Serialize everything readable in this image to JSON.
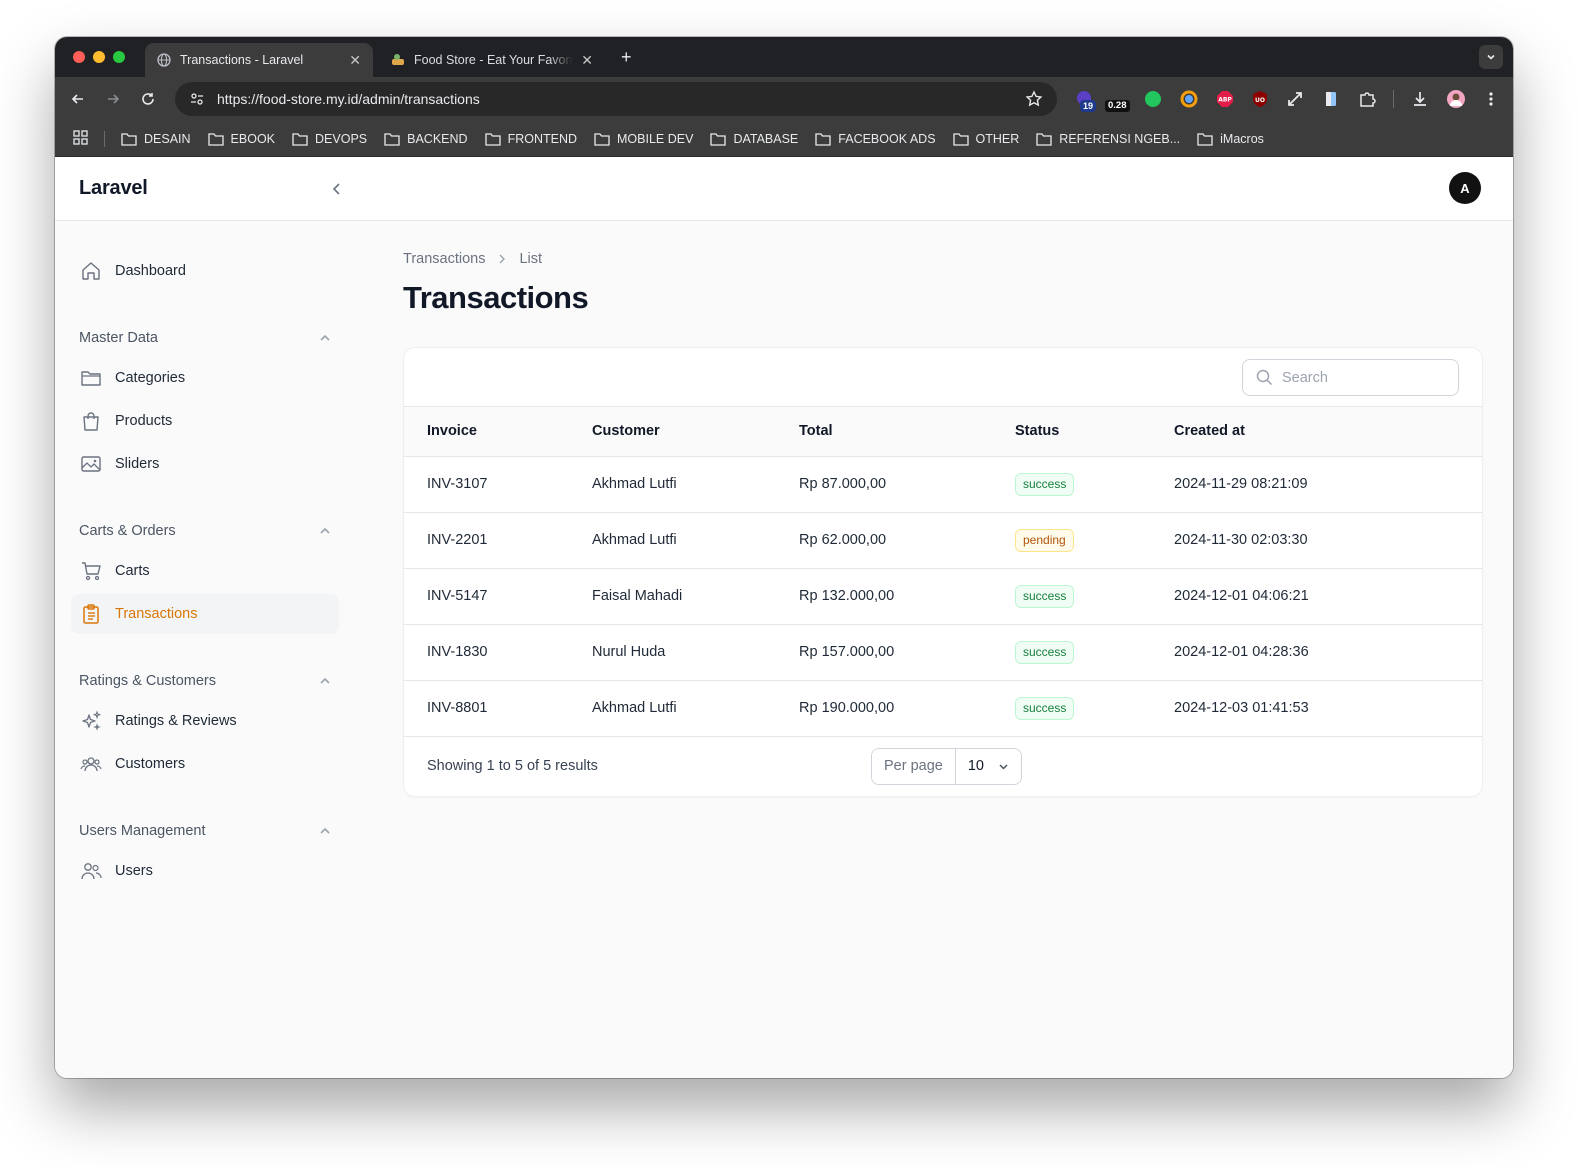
{
  "browser": {
    "tabs": [
      {
        "title": "Transactions - Laravel",
        "active": true
      },
      {
        "title": "Food Store - Eat Your Favorite",
        "active": false
      }
    ],
    "url": "https://food-store.my.id/admin/transactions",
    "extension_badges": {
      "badge1": "19",
      "badge2": "0.28"
    },
    "bookmarks": [
      "DESAIN",
      "EBOOK",
      "DEVOPS",
      "BACKEND",
      "FRONTEND",
      "MOBILE DEV",
      "DATABASE",
      "FACEBOOK ADS",
      "OTHER",
      "REFERENSI NGEB...",
      "iMacros"
    ]
  },
  "app": {
    "brand": "Laravel",
    "avatar_initial": "A",
    "accent_color": "#d97706"
  },
  "sidebar": {
    "dashboard": "Dashboard",
    "groups": [
      {
        "label": "Master Data",
        "items": [
          "Categories",
          "Products",
          "Sliders"
        ]
      },
      {
        "label": "Carts & Orders",
        "items": [
          "Carts",
          "Transactions"
        ]
      },
      {
        "label": "Ratings & Customers",
        "items": [
          "Ratings & Reviews",
          "Customers"
        ]
      },
      {
        "label": "Users Management",
        "items": [
          "Users"
        ]
      }
    ]
  },
  "main": {
    "breadcrumb": [
      "Transactions",
      "List"
    ],
    "title": "Transactions",
    "search_placeholder": "Search",
    "columns": [
      "Invoice",
      "Customer",
      "Total",
      "Status",
      "Created at"
    ],
    "rows": [
      {
        "invoice": "INV-3107",
        "customer": "Akhmad Lutfi",
        "total": "Rp 87.000,00",
        "status": "success",
        "created_at": "2024-11-29 08:21:09"
      },
      {
        "invoice": "INV-2201",
        "customer": "Akhmad Lutfi",
        "total": "Rp 62.000,00",
        "status": "pending",
        "created_at": "2024-11-30 02:03:30"
      },
      {
        "invoice": "INV-5147",
        "customer": "Faisal Mahadi",
        "total": "Rp 132.000,00",
        "status": "success",
        "created_at": "2024-12-01 04:06:21"
      },
      {
        "invoice": "INV-1830",
        "customer": "Nurul Huda",
        "total": "Rp 157.000,00",
        "status": "success",
        "created_at": "2024-12-01 04:28:36"
      },
      {
        "invoice": "INV-8801",
        "customer": "Akhmad Lutfi",
        "total": "Rp 190.000,00",
        "status": "success",
        "created_at": "2024-12-03 01:41:53"
      }
    ],
    "footer": {
      "showing": "Showing 1 to 5 of 5 results",
      "per_page_label": "Per page",
      "per_page_value": "10"
    }
  }
}
